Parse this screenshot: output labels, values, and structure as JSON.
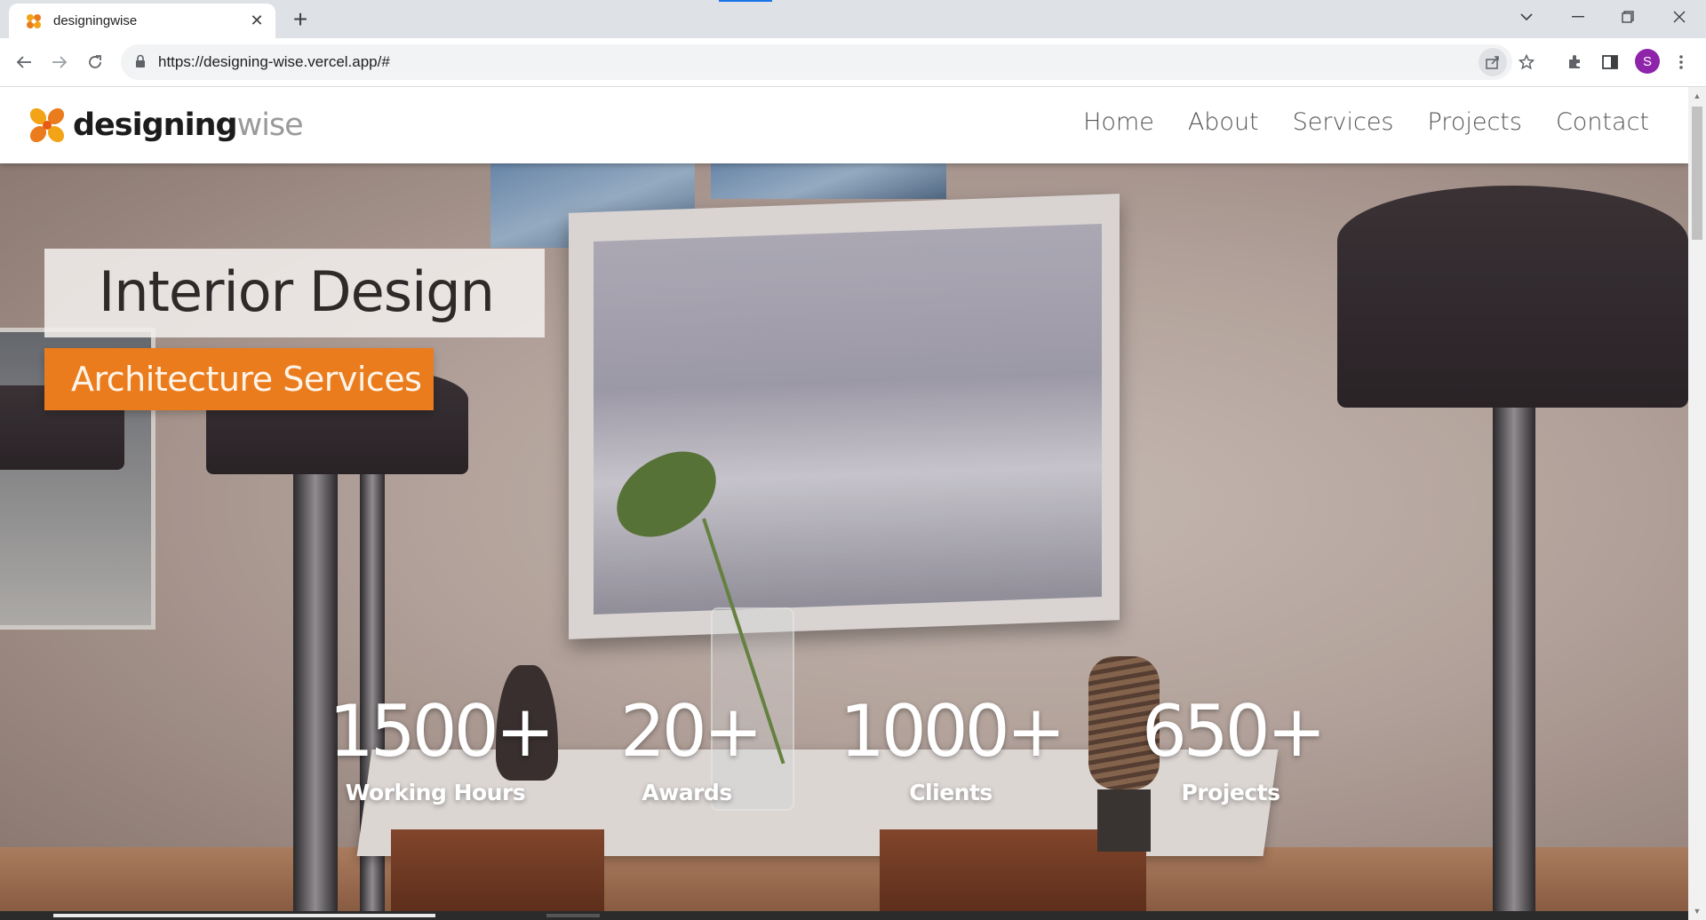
{
  "browser": {
    "tab_title": "designingwise",
    "url": "https://designing-wise.vercel.app/#",
    "profile_initial": "S",
    "new_tab_symbol": "+",
    "close_symbol": "✕"
  },
  "site": {
    "logo_bold": "designing",
    "logo_light": "wise",
    "nav": [
      "Home",
      "About",
      "Services",
      "Projects",
      "Contact"
    ]
  },
  "hero": {
    "title": "Interior Design",
    "subtitle": "Architecture Services",
    "stats": [
      {
        "value": "1500+",
        "label": "Working Hours"
      },
      {
        "value": "20+",
        "label": "Awards"
      },
      {
        "value": "1000+",
        "label": "Clients"
      },
      {
        "value": "650+",
        "label": "Projects"
      }
    ]
  },
  "colors": {
    "accent": "#ea7c1e",
    "profile": "#8e24aa"
  },
  "icons": [
    "back-arrow-icon",
    "forward-arrow-icon",
    "reload-icon",
    "lock-icon",
    "share-icon",
    "star-icon",
    "extensions-icon",
    "side-panel-icon",
    "menu-kebab-icon",
    "tab-search-icon",
    "minimize-icon",
    "maximize-icon",
    "close-window-icon"
  ]
}
